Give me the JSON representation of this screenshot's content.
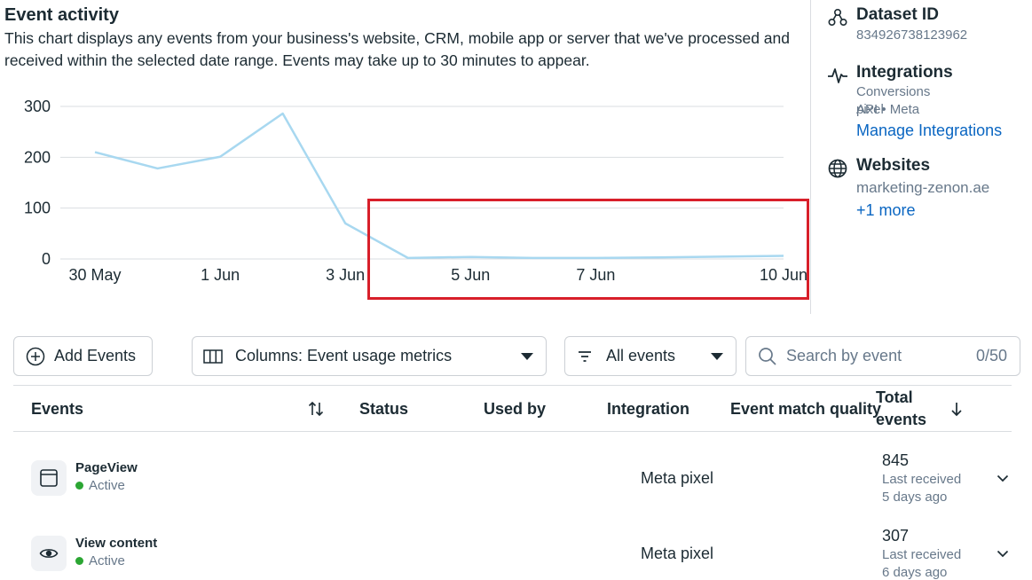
{
  "header": {
    "title": "Event activity",
    "description": "This chart displays any events from your business's website, CRM, mobile app or server that we've processed and received within the selected date range. Events may take up to 30 minutes to appear."
  },
  "chart_data": {
    "type": "line",
    "title": "",
    "xlabel": "",
    "ylabel": "",
    "x_tick_labels": [
      "30 May",
      "1 Jun",
      "3 Jun",
      "5 Jun",
      "7 Jun",
      "10 Jun"
    ],
    "y_ticks": [
      0,
      100,
      200,
      300
    ],
    "ylim": [
      0,
      300
    ],
    "grid": true,
    "series": [
      {
        "color": "#a8d8f0",
        "points": [
          {
            "x": "30 May",
            "y": 210
          },
          {
            "x": "31 May",
            "y": 178
          },
          {
            "x": "1 Jun",
            "y": 201
          },
          {
            "x": "2 Jun",
            "y": 286
          },
          {
            "x": "3 Jun",
            "y": 70
          },
          {
            "x": "4 Jun",
            "y": 2
          },
          {
            "x": "5 Jun",
            "y": 4
          },
          {
            "x": "6 Jun",
            "y": 2
          },
          {
            "x": "7 Jun",
            "y": 2
          },
          {
            "x": "8 Jun",
            "y": 3
          },
          {
            "x": "10 Jun",
            "y": 6
          }
        ]
      }
    ]
  },
  "sidebar": {
    "dataset": {
      "label": "Dataset ID",
      "value": "834926738123962",
      "icon": "dataset-icon"
    },
    "integrations": {
      "label": "Integrations",
      "value_line1": "Conversions API • Meta",
      "value_line2": "pixel",
      "link": "Manage Integrations",
      "icon": "pulse-icon"
    },
    "websites": {
      "label": "Websites",
      "value": "marketing-zenon.ae",
      "link": "+1 more",
      "icon": "globe-icon"
    }
  },
  "toolbar": {
    "add_events": "Add Events",
    "columns": "Columns: Event usage metrics",
    "filter": "All events",
    "search_placeholder": "Search by event",
    "search_count": "0/50"
  },
  "table": {
    "headers": {
      "events": "Events",
      "status": "Status",
      "used_by": "Used by",
      "integration": "Integration",
      "match_quality": "Event match quality",
      "total_line1": "Total",
      "total_line2": "events"
    },
    "rows": [
      {
        "name": "PageView",
        "status": "Active",
        "integration": "Meta pixel",
        "total": "845",
        "last_label": "Last received",
        "last_time": "5 days ago",
        "icon": "browser-window-icon"
      },
      {
        "name": "View content",
        "status": "Active",
        "integration": "Meta pixel",
        "total": "307",
        "last_label": "Last received",
        "last_time": "6 days ago",
        "icon": "eye-icon"
      }
    ]
  },
  "colors": {
    "accent_link": "#0a66c2",
    "line": "#a8d8f0",
    "highlight_box": "#d81f2a",
    "status_active": "#2ba633"
  }
}
